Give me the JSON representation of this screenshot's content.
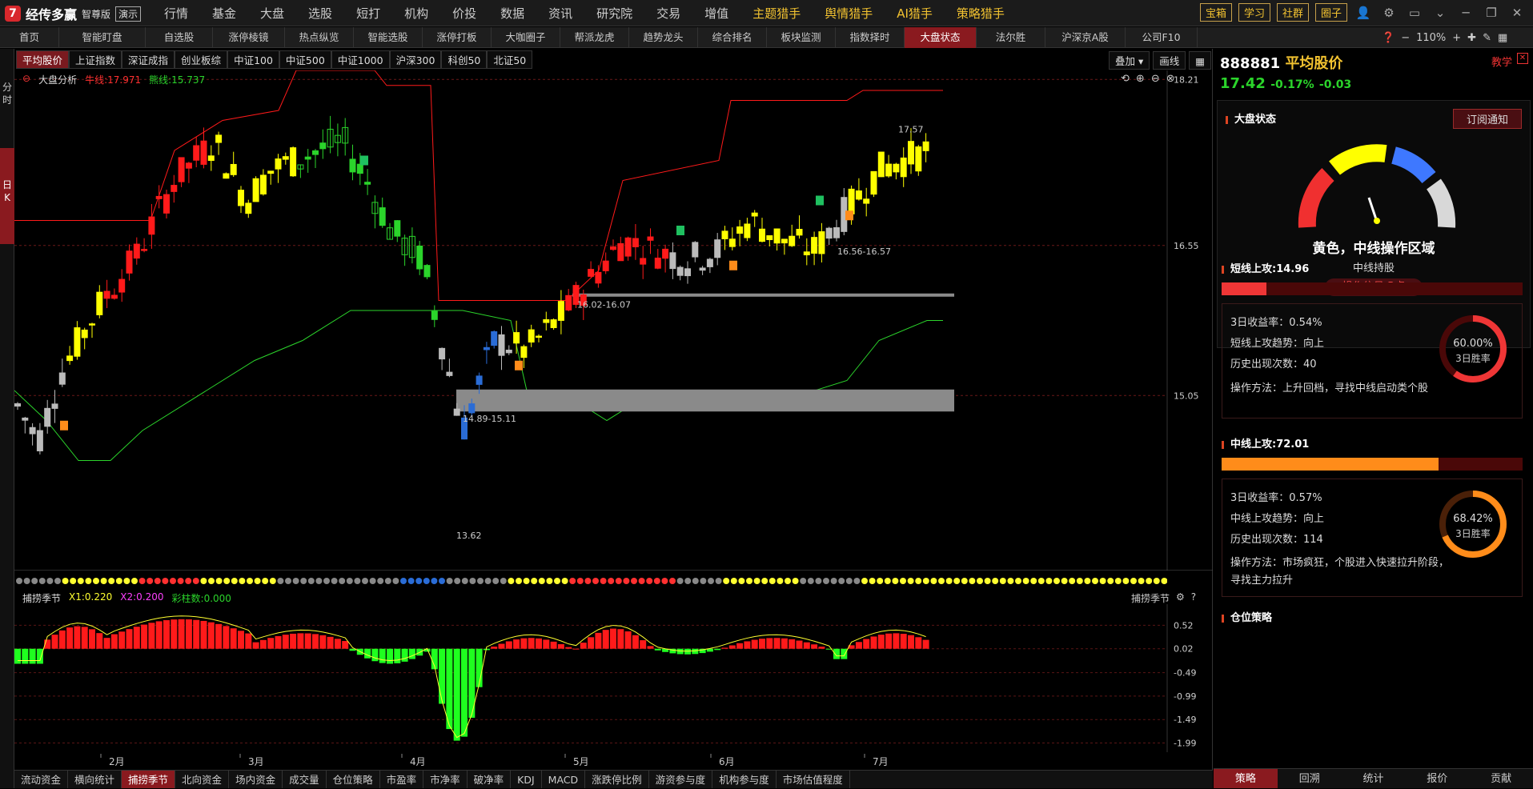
{
  "app": {
    "name": "经传多赢",
    "edition": "智尊版",
    "demo": "演示"
  },
  "menu": [
    {
      "label": "行情",
      "hl": false
    },
    {
      "label": "基金",
      "hl": false
    },
    {
      "label": "大盘",
      "hl": false
    },
    {
      "label": "选股",
      "hl": false
    },
    {
      "label": "短打",
      "hl": false
    },
    {
      "label": "机构",
      "hl": false
    },
    {
      "label": "价投",
      "hl": false
    },
    {
      "label": "数据",
      "hl": false,
      "dot": true
    },
    {
      "label": "资讯",
      "hl": false
    },
    {
      "label": "研究院",
      "hl": false
    },
    {
      "label": "交易",
      "hl": false
    },
    {
      "label": "增值",
      "hl": false
    },
    {
      "label": "主题猎手",
      "hl": true
    },
    {
      "label": "舆情猎手",
      "hl": true
    },
    {
      "label": "AI猎手",
      "hl": true
    },
    {
      "label": "策略猎手",
      "hl": true
    }
  ],
  "topright": [
    "宝箱",
    "学习",
    "社群",
    "圈子"
  ],
  "nav": [
    "首页",
    "智能盯盘",
    "自选股",
    "涨停棱镜",
    "热点纵览",
    "智能选股",
    "涨停打板",
    "大咖圈子",
    "帮派龙虎",
    "趋势龙头",
    "综合排名",
    "板块监测",
    "指数择时",
    "大盘状态",
    "法尔胜",
    "沪深京A股",
    "公司F10"
  ],
  "nav_active": "大盘状态",
  "zoom": "110%",
  "left_strip": {
    "fenshi": "分时",
    "rik": "日K"
  },
  "index_tabs": [
    "平均股价",
    "上证指数",
    "深证成指",
    "创业板综",
    "中证100",
    "中证500",
    "中证1000",
    "沪深300",
    "科创50",
    "北证50"
  ],
  "index_active": "平均股价",
  "chart_header": {
    "title": "大盘分析",
    "bull_label": "牛线:17.971",
    "bear_label": "熊线:15.737"
  },
  "chart_tools": {
    "overlay": "叠加",
    "draw": "画线"
  },
  "chart_data": {
    "type": "candlestick",
    "y_ticks": [
      18.21,
      16.55,
      15.05
    ],
    "y_range": [
      13.3,
      18.3
    ],
    "annotations": [
      "17.57",
      "16.56-16.57",
      "16.02-16.07",
      "14.89-15.11",
      "13.62"
    ],
    "month_labels": [
      "2月",
      "3月",
      "4月",
      "5月",
      "6月",
      "7月"
    ],
    "bull_line": 17.971,
    "bear_line": 15.737
  },
  "sub_chart": {
    "title": "捕捞季节",
    "x1": "X1:0.220",
    "x2": "X2:0.200",
    "bars": "彩柱数:0.000",
    "tag": "捕捞季节",
    "y_ticks": [
      "0.52",
      "0.02",
      "-0.49",
      "-0.99",
      "-1.49",
      "-1.99"
    ]
  },
  "chart_bottom_tabs": [
    "流动资金",
    "横向统计",
    "捕捞季节",
    "北向资金",
    "场内资金",
    "成交量",
    "仓位策略",
    "市盈率",
    "市净率",
    "破净率",
    "KDJ",
    "MACD",
    "涨跌停比例",
    "游资参与度",
    "机构参与度",
    "市场估值程度"
  ],
  "chart_bottom_active": "捕捞季节",
  "rpanel": {
    "code": "888881",
    "name": "平均股价",
    "teach": "教学",
    "price": "17.42",
    "pct": "-0.17%",
    "chg": "-0.03",
    "status": {
      "title": "大盘状态",
      "subscribe": "订阅通知",
      "headline": "黄色，中线操作区域",
      "sub": "中线持股",
      "signal": "操作信号:B点"
    },
    "short": {
      "title": "短线上攻:14.96",
      "fill": 0.15,
      "ret": "3日收益率：0.54%",
      "trend": "短线上攻趋势：向上",
      "count": "历史出现次数：40",
      "method": "操作方法：上升回档，寻找中线启动类个股",
      "win": "60.00%",
      "win_label": "3日胜率",
      "win_value": 0.6
    },
    "mid": {
      "title": "中线上攻:72.01",
      "fill": 0.72,
      "ret": "3日收益率：0.57%",
      "trend": "中线上攻趋势：向上",
      "count": "历史出现次数：114",
      "method": "操作方法：市场疯狂，个股进入快速拉升阶段，寻找主力拉升",
      "win": "68.42%",
      "win_label": "3日胜率",
      "win_value": 0.684
    },
    "pos": "仓位策略",
    "tabs": [
      "策略",
      "回溯",
      "统计",
      "报价",
      "贡献"
    ],
    "tab_active": "策略"
  },
  "colors": {
    "up": "#ff1a1a",
    "yellow": "#ffff00",
    "green": "#2bd42b",
    "blue": "#2a6cd6",
    "accent": "#8a1a1f",
    "orange": "#ff8c1a",
    "gold": "#f2c230"
  }
}
